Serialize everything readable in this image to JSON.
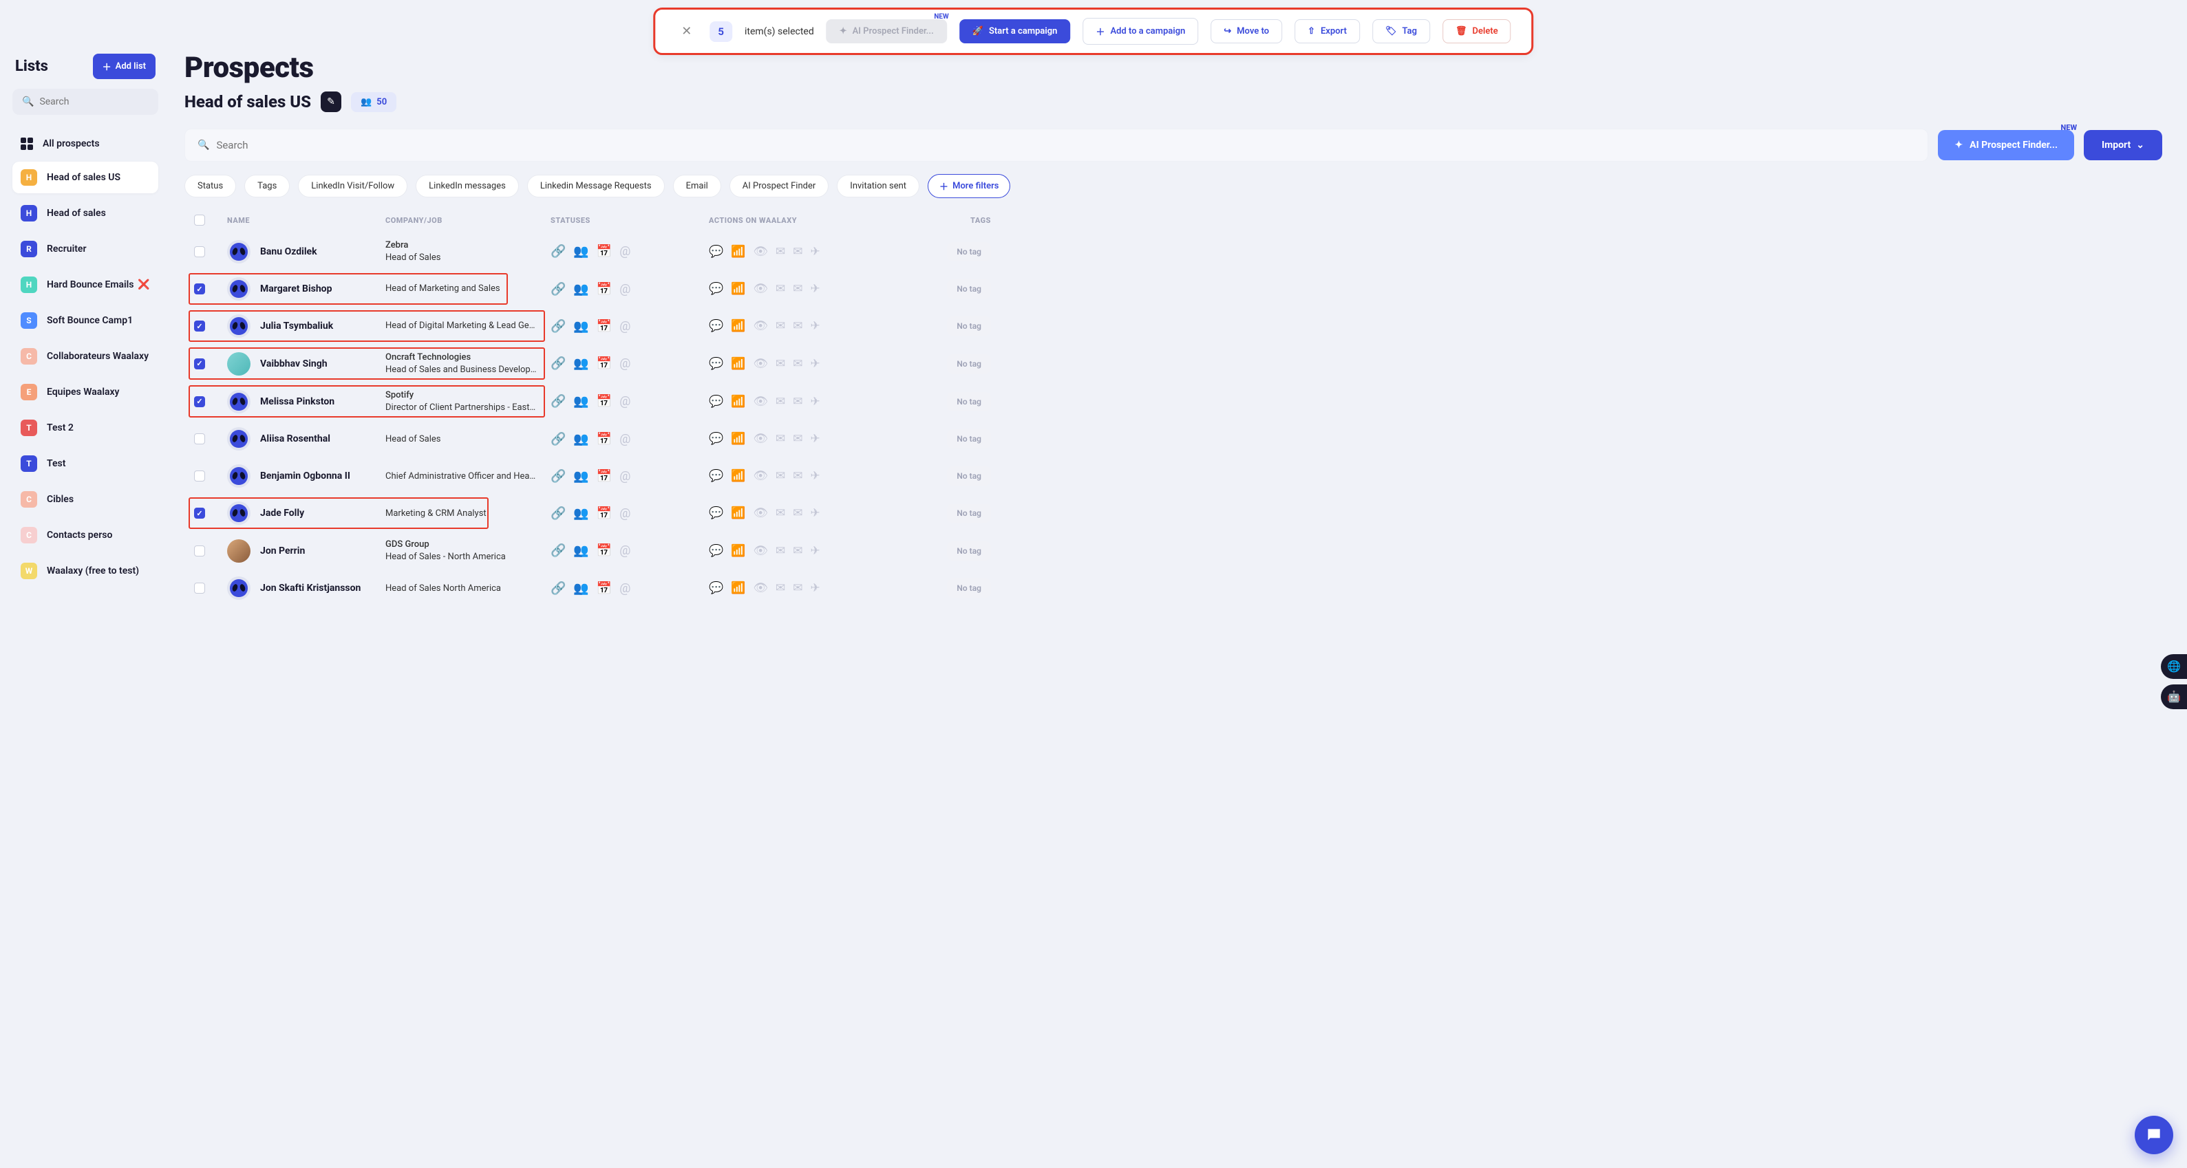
{
  "action_bar": {
    "count": "5",
    "selected_text": "item(s) selected",
    "ai_finder": "AI Prospect Finder...",
    "new_badge": "NEW",
    "start_campaign": "Start a campaign",
    "add_campaign": "Add to a campaign",
    "move_to": "Move to",
    "export": "Export",
    "tag": "Tag",
    "delete": "Delete"
  },
  "sidebar": {
    "title": "Lists",
    "add_list": "Add list",
    "search_placeholder": "Search",
    "all_prospects": "All prospects",
    "items": [
      {
        "letter": "H",
        "label": "Head of sales US",
        "color": "#f5b041",
        "active": true
      },
      {
        "letter": "H",
        "label": "Head of sales",
        "color": "#3b4bdb"
      },
      {
        "letter": "R",
        "label": "Recruiter",
        "color": "#3b4bdb"
      },
      {
        "letter": "H",
        "label": "Hard Bounce Emails",
        "color": "#4fd6c0",
        "extra": "❌"
      },
      {
        "letter": "S",
        "label": "Soft Bounce Camp1",
        "color": "#4f8cff"
      },
      {
        "letter": "C",
        "label": "Collaborateurs Waalaxy",
        "color": "#f6b9a8"
      },
      {
        "letter": "E",
        "label": "Equipes Waalaxy",
        "color": "#f5a07a"
      },
      {
        "letter": "T",
        "label": "Test 2",
        "color": "#e85a5a"
      },
      {
        "letter": "T",
        "label": "Test",
        "color": "#3b4bdb"
      },
      {
        "letter": "C",
        "label": "Cibles",
        "color": "#f6b9a8"
      },
      {
        "letter": "C",
        "label": "Contacts perso",
        "color": "#f7cfd0"
      },
      {
        "letter": "W",
        "label": "Waalaxy (free to test)",
        "color": "#f3d96b"
      }
    ]
  },
  "main": {
    "title": "Prospects",
    "list_name": "Head of sales US",
    "count": "50",
    "search_placeholder": "Search",
    "ai_finder": "AI Prospect Finder...",
    "ai_new": "NEW",
    "import": "Import"
  },
  "filters": [
    "Status",
    "Tags",
    "LinkedIn Visit/Follow",
    "LinkedIn messages",
    "Linkedin Message Requests",
    "Email",
    "AI Prospect Finder",
    "Invitation sent"
  ],
  "more_filters": "More filters",
  "columns": {
    "name": "NAME",
    "company": "COMPANY/JOB",
    "statuses": "STATUSES",
    "actions": "ACTIONS ON WAALAXY",
    "tags": "TAGS"
  },
  "no_tag": "No tag",
  "rows": [
    {
      "checked": false,
      "name": "Banu Ozdilek",
      "company": "Zebra",
      "job": "Head of Sales",
      "avatar": "alien",
      "hl": ""
    },
    {
      "checked": true,
      "name": "Margaret Bishop",
      "company": "",
      "job": "Head of Marketing and Sales",
      "avatar": "alien",
      "hl": "w-460"
    },
    {
      "checked": true,
      "name": "Julia Tsymbaliuk",
      "company": "",
      "job": "Head of Digital Marketing & Lead Genera...",
      "avatar": "alien",
      "hl": "w-514"
    },
    {
      "checked": true,
      "name": "Vaibbhav Singh",
      "company": "Oncraft Technologies",
      "job": "Head of Sales and Business Development",
      "avatar": "photo1",
      "hl": "w-514"
    },
    {
      "checked": true,
      "name": "Melissa Pinkston",
      "company": "Spotify",
      "job": "Director of Client Partnerships - East at …",
      "avatar": "alien",
      "hl": "w-514"
    },
    {
      "checked": false,
      "name": "Aliisa Rosenthal",
      "company": "",
      "job": "Head of Sales",
      "avatar": "alien",
      "hl": ""
    },
    {
      "checked": false,
      "name": "Benjamin Ogbonna II",
      "company": "",
      "job": "Chief Administrative Officer and Head of ...",
      "avatar": "alien",
      "hl": ""
    },
    {
      "checked": true,
      "name": "Jade Folly",
      "company": "",
      "job": "Marketing & CRM Analyst",
      "avatar": "alien",
      "hl": "w-432"
    },
    {
      "checked": false,
      "name": "Jon Perrin",
      "company": "GDS Group",
      "job": "Head of Sales - North America",
      "avatar": "photo2",
      "hl": ""
    },
    {
      "checked": false,
      "name": "Jon Skafti Kristjansson",
      "company": "",
      "job": "Head of Sales North America",
      "avatar": "alien",
      "hl": ""
    }
  ]
}
